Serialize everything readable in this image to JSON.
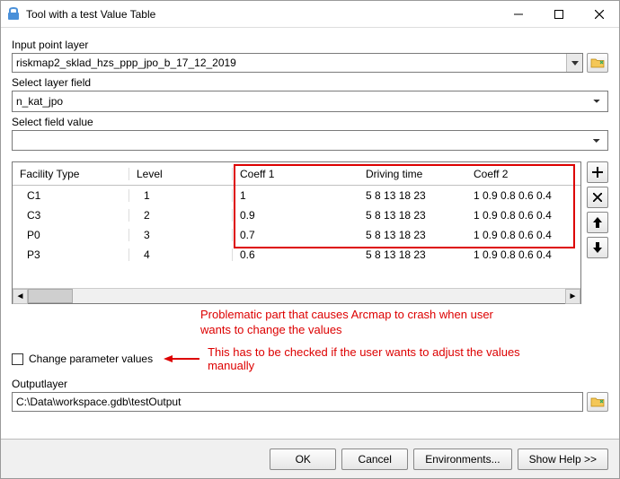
{
  "window": {
    "title": "Tool with a test Value Table"
  },
  "labels": {
    "input_point_layer": "Input point layer",
    "select_layer_field": "Select layer field",
    "select_field_value": "Select field value",
    "change_param": "Change parameter values",
    "output_layer": "Outputlayer"
  },
  "fields": {
    "input_point_layer": "riskmap2_sklad_hzs_ppp_jpo_b_17_12_2019",
    "select_layer_field": "n_kat_jpo",
    "select_field_value": "",
    "output_layer": "C:\\Data\\workspace.gdb\\testOutput"
  },
  "table": {
    "headers": {
      "facility_type": "Facility Type",
      "level": "Level",
      "coeff1": "Coeff 1",
      "driving_time": "Driving time",
      "coeff2": "Coeff 2"
    },
    "rows": [
      {
        "ft": "C1",
        "lv": "1",
        "c1": "1",
        "dt": "5 8 13 18 23",
        "c2": "1 0.9 0.8 0.6 0.4"
      },
      {
        "ft": "C3",
        "lv": "2",
        "c1": "0.9",
        "dt": "5 8 13 18 23",
        "c2": "1 0.9 0.8 0.6 0.4"
      },
      {
        "ft": "P0",
        "lv": "3",
        "c1": "0.7",
        "dt": "5 8 13 18 23",
        "c2": "1 0.9 0.8 0.6 0.4"
      },
      {
        "ft": "P3",
        "lv": "4",
        "c1": "0.6",
        "dt": "5 8 13 18 23",
        "c2": "1 0.9 0.8 0.6 0.4"
      }
    ]
  },
  "annotations": {
    "table_note_l1": "Problematic part that causes Arcmap to crash when user",
    "table_note_l2": "wants to change the values",
    "check_note_l1": "This has to be checked if the user wants to adjust the values",
    "check_note_l2": "manually"
  },
  "buttons": {
    "ok": "OK",
    "cancel": "Cancel",
    "env": "Environments...",
    "help": "Show Help >>"
  }
}
